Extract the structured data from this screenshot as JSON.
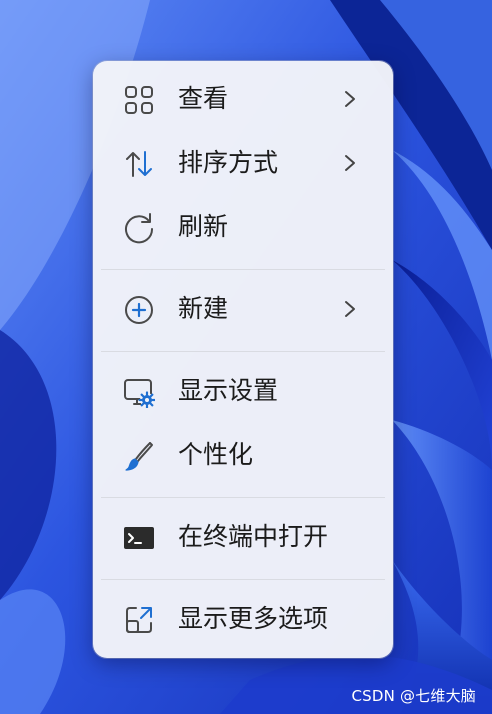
{
  "menu": {
    "items": [
      {
        "label": "查看",
        "icon": "view-grid-icon",
        "submenu": true
      },
      {
        "label": "排序方式",
        "icon": "sort-arrows-icon",
        "submenu": true
      },
      {
        "label": "刷新",
        "icon": "refresh-icon",
        "submenu": false
      },
      {
        "label": "新建",
        "icon": "new-plus-circle-icon",
        "submenu": true
      },
      {
        "label": "显示设置",
        "icon": "display-settings-icon",
        "submenu": false
      },
      {
        "label": "个性化",
        "icon": "paintbrush-icon",
        "submenu": false
      },
      {
        "label": "在终端中打开",
        "icon": "terminal-icon",
        "submenu": false
      },
      {
        "label": "显示更多选项",
        "icon": "show-more-options-icon",
        "submenu": false
      }
    ]
  },
  "watermark": "CSDN @七维大脑",
  "colors": {
    "accent": "#1f6fd1",
    "icon_gray": "#5b5b5b",
    "menu_bg": "#f3f4f9",
    "wallpaper_dark": "#0d2cb0",
    "wallpaper_light": "#3d6cf0"
  }
}
